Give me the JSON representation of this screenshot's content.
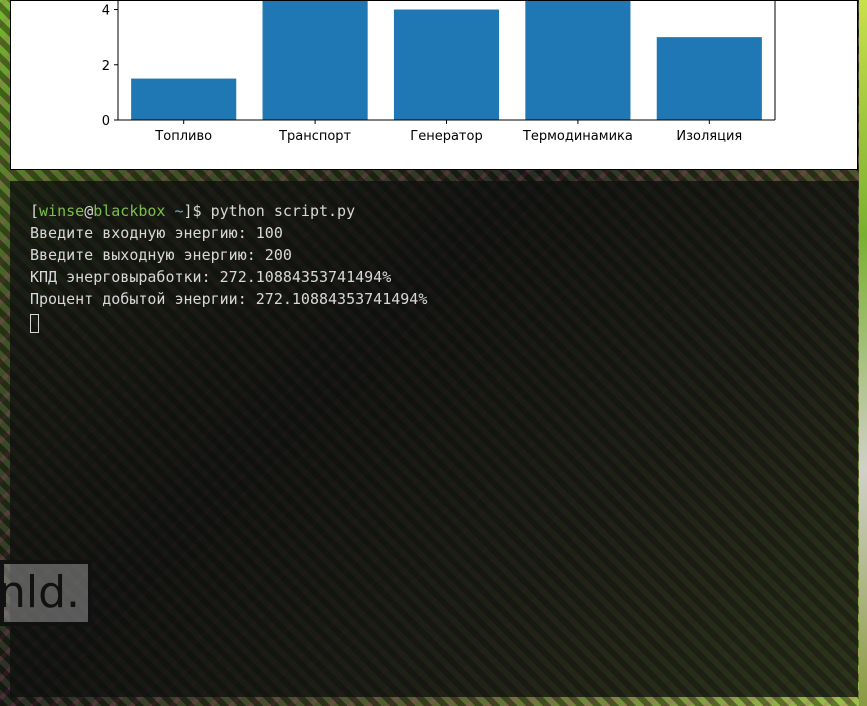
{
  "chart_data": {
    "type": "bar",
    "categories": [
      "Топливо",
      "Транспорт",
      "Генератор",
      "Термодинамика",
      "Изоляция"
    ],
    "values": [
      1.5,
      4.8,
      4.0,
      4.8,
      3.0
    ],
    "yticks": [
      "0",
      "2",
      "4"
    ],
    "ylim": [
      0,
      4.2
    ],
    "bar_color": "#1f77b4",
    "grid": false
  },
  "terminal": {
    "prompt": {
      "user": "winse",
      "host": "blackbox",
      "path": "~",
      "command": "python script.py"
    },
    "output": [
      "Введите входную энергию: 100",
      "Введите выходную энергию: 200",
      "КПД энерговыработки: 272.10884353741494%",
      "Процент добытой энергии: 272.10884353741494%"
    ]
  },
  "wallpaper": {
    "overlay_text": "nld."
  },
  "colors": {
    "terminal_bg": "#0e100e",
    "prompt_green": "#7bbf4a",
    "text": "#d8d8d8"
  }
}
